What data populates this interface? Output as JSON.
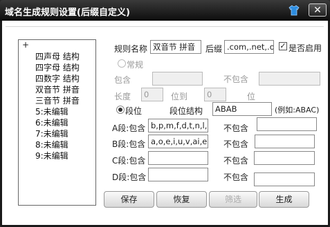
{
  "window": {
    "title": "域名生成规则设置(后缀自定义)"
  },
  "tree": {
    "root_label": "+",
    "items": [
      "四声母 结构",
      "四字母 结构",
      "四数字 结构",
      "双音节 拼音",
      "三音节 拼音",
      "5:未编辑",
      "6:未编辑",
      "7:未编辑",
      "8:未编辑",
      "9:未编辑"
    ]
  },
  "form": {
    "rule_name_label": "规则名称",
    "rule_name_value": "双音节 拼音",
    "suffix_label": "后缀",
    "suffix_value": ".com,.net,.or",
    "enable_label": "是否启用",
    "enable_checked": true,
    "normal_label": "常规",
    "include_label": "包含",
    "exclude_label": "不包含",
    "length_label": "长度",
    "length_from": "0",
    "to_label": "位到",
    "length_to": "0",
    "unit_label": "位",
    "segment_label": "段位",
    "segment_structure_label": "段位结构",
    "segment_structure_value": "ABAB",
    "example_label": "(例如:ABAC)",
    "segments": [
      {
        "include_label": "A段:包含",
        "include_value": "b,p,m,f,d,t,n,l,g",
        "exclude_label": "不包含",
        "exclude_value": ""
      },
      {
        "include_label": "B段:包含",
        "include_value": "a,o,e,i,u,v,ai,ei,",
        "exclude_label": "不包含",
        "exclude_value": ""
      },
      {
        "include_label": "C段:包含",
        "include_value": "",
        "exclude_label": "不包含",
        "exclude_value": ""
      },
      {
        "include_label": "D段:包含",
        "include_value": "",
        "exclude_label": "不包含",
        "exclude_value": ""
      }
    ]
  },
  "buttons": {
    "save": "保存",
    "restore": "恢复",
    "filter": "筛选",
    "generate": "生成"
  },
  "colors": {
    "titlebar": "#1a1a1a",
    "title_text": "#ffffff",
    "client_bg": "#ffffff"
  }
}
